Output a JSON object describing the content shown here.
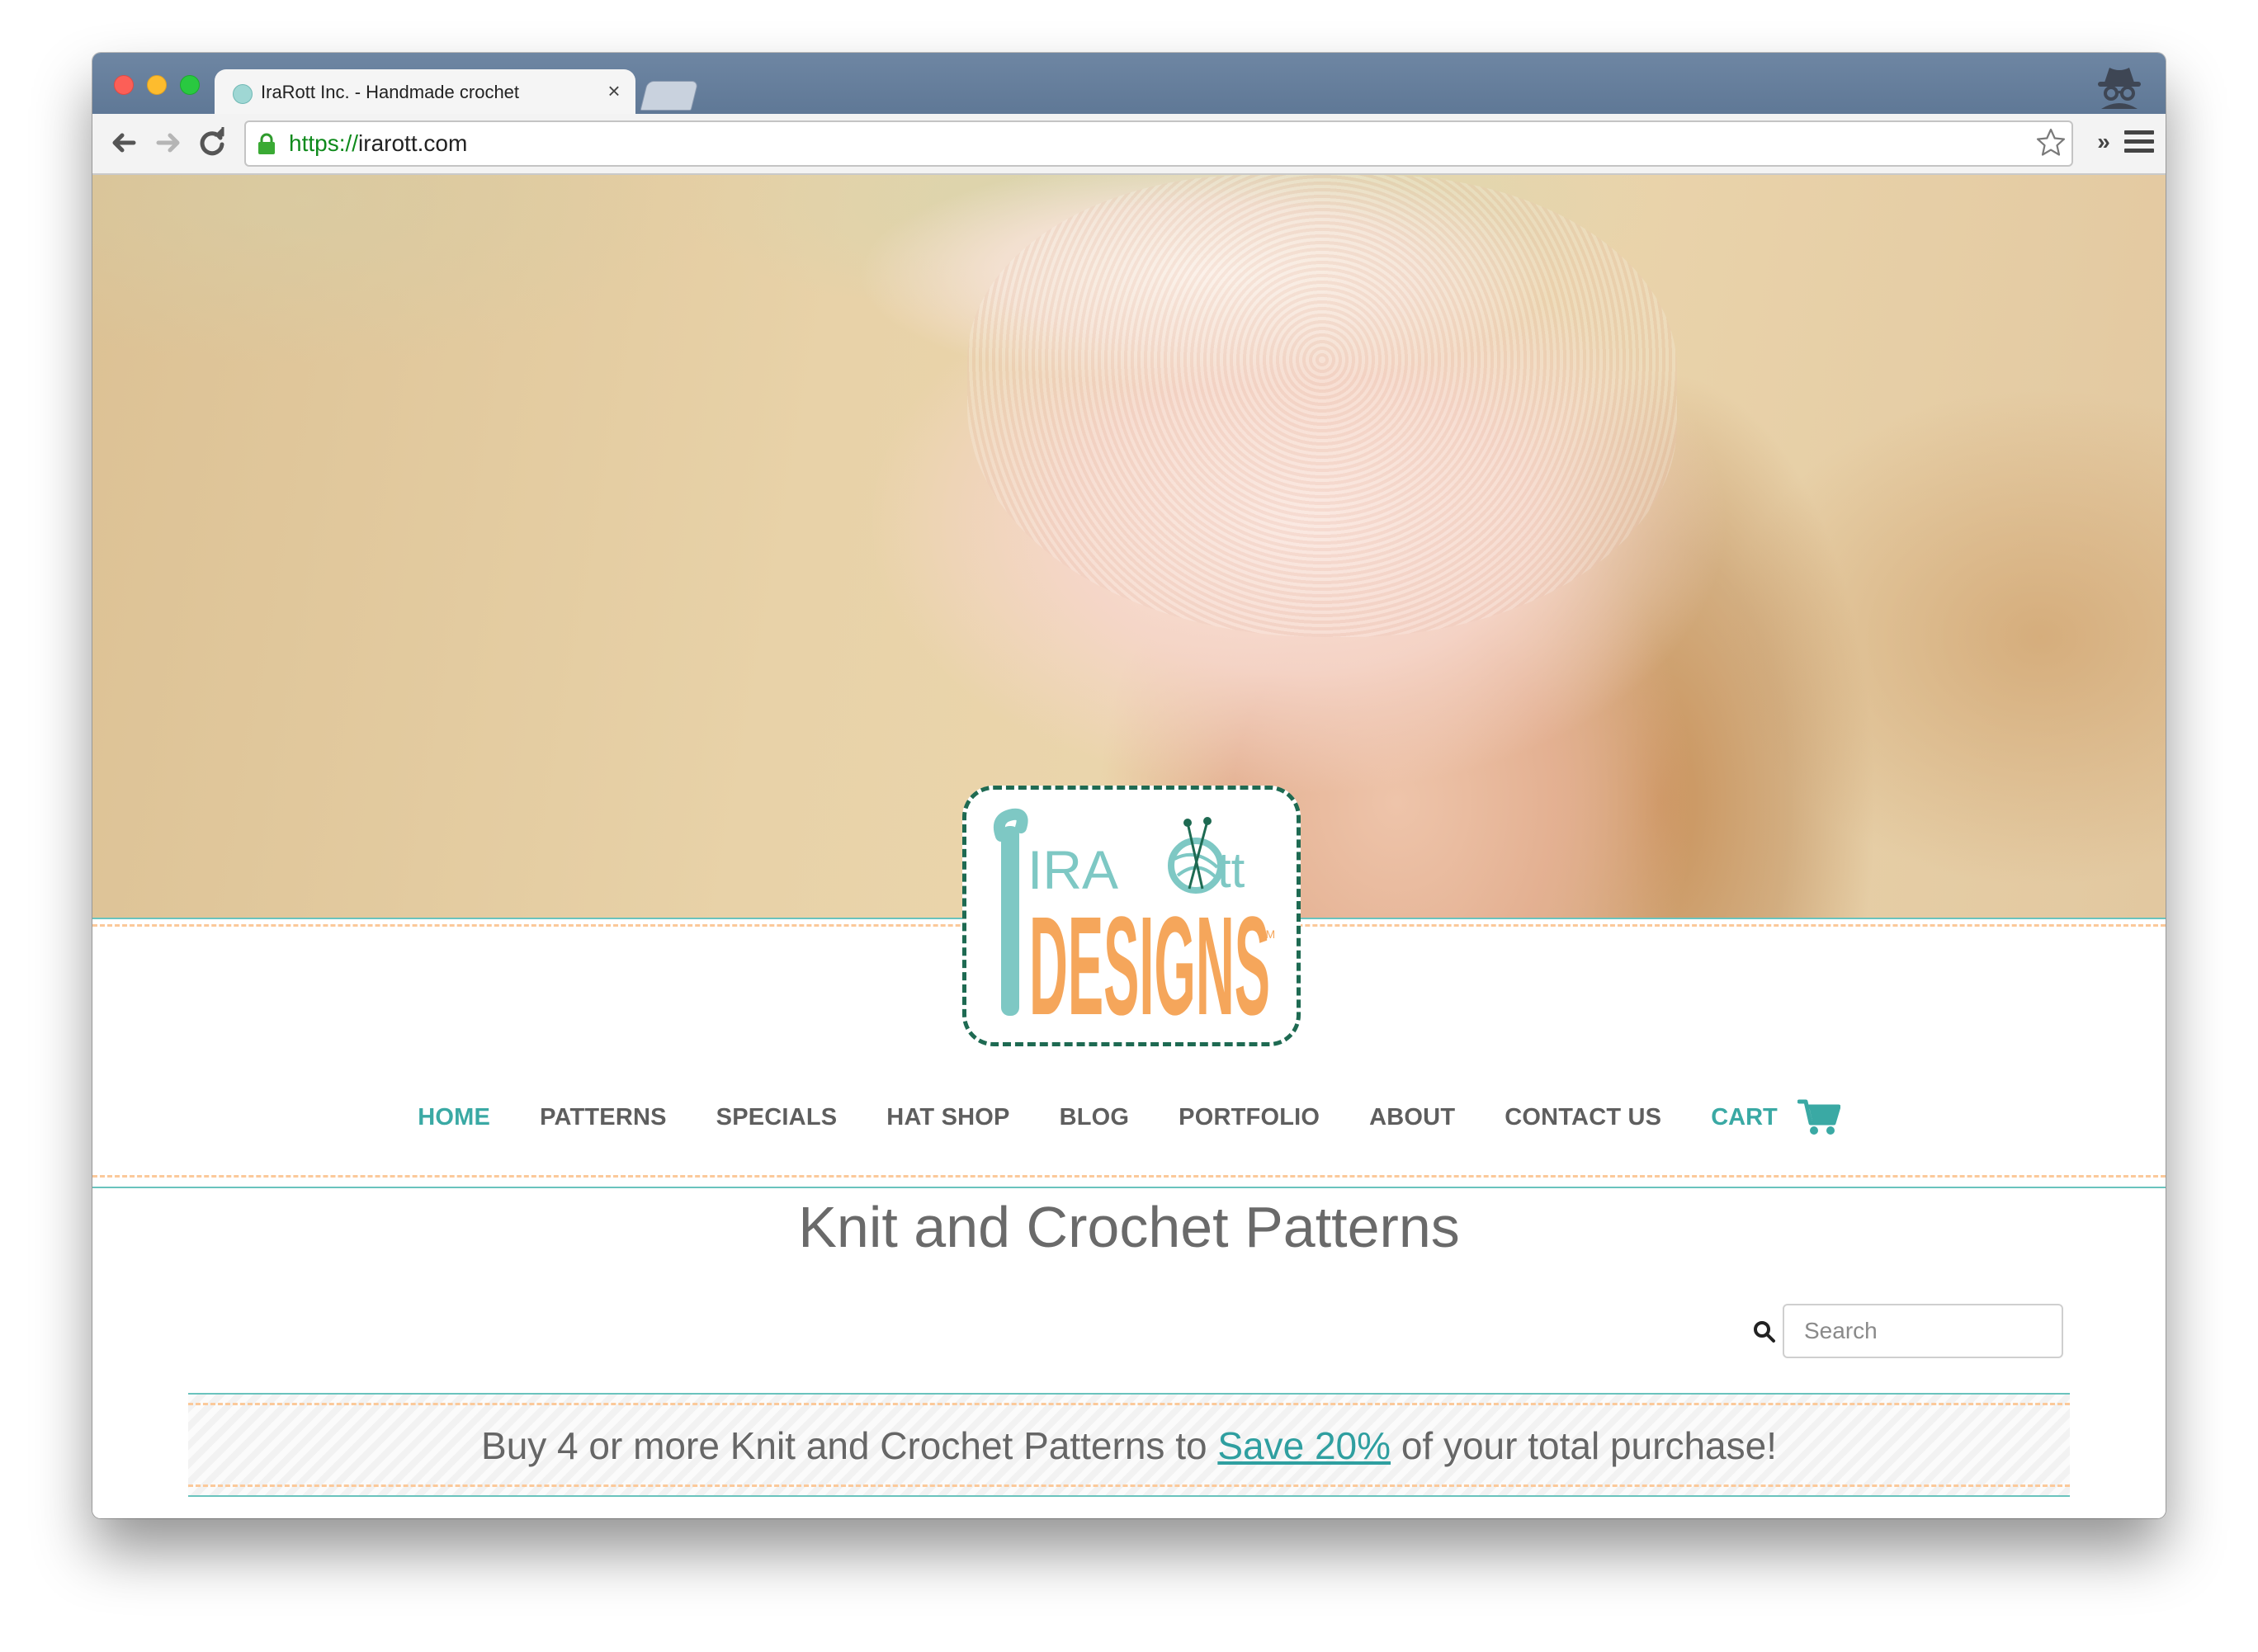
{
  "browser": {
    "tab_title": "IraRott Inc. - Handmade crochet",
    "tab_close": "×",
    "url_scheme": "https://",
    "url_host": "irarott.com",
    "extensions_glyph": "»"
  },
  "site": {
    "logo": {
      "word_ira": "IRA",
      "word_rott": "Rott",
      "word_designs": "DESIGNS",
      "tm": "TM",
      "colors": {
        "teal": "#7ec8c4",
        "orange": "#f5a65b",
        "border": "#1e6a52"
      }
    },
    "nav": [
      {
        "label": "HOME",
        "active": true
      },
      {
        "label": "PATTERNS",
        "active": false
      },
      {
        "label": "SPECIALS",
        "active": false
      },
      {
        "label": "HAT SHOP",
        "active": false
      },
      {
        "label": "BLOG",
        "active": false
      },
      {
        "label": "PORTFOLIO",
        "active": false
      },
      {
        "label": "ABOUT",
        "active": false
      },
      {
        "label": "CONTACT US",
        "active": false
      }
    ],
    "cart": {
      "label": "CART",
      "icon": "cart-icon"
    },
    "heading": "Knit and Crochet Patterns",
    "search": {
      "placeholder": "Search",
      "icon": "search-icon"
    },
    "promo": {
      "before": "Buy 4 or more Knit and Crochet Patterns to ",
      "link": "Save 20%",
      "after": " of your total purchase!"
    },
    "accent_color": "#3aa9a4",
    "dash_color": "#fbc99a",
    "card_ring_colors": [
      "#52b9b4",
      "#f5a65b",
      "#9ccc4a",
      "#d95aa8"
    ]
  }
}
